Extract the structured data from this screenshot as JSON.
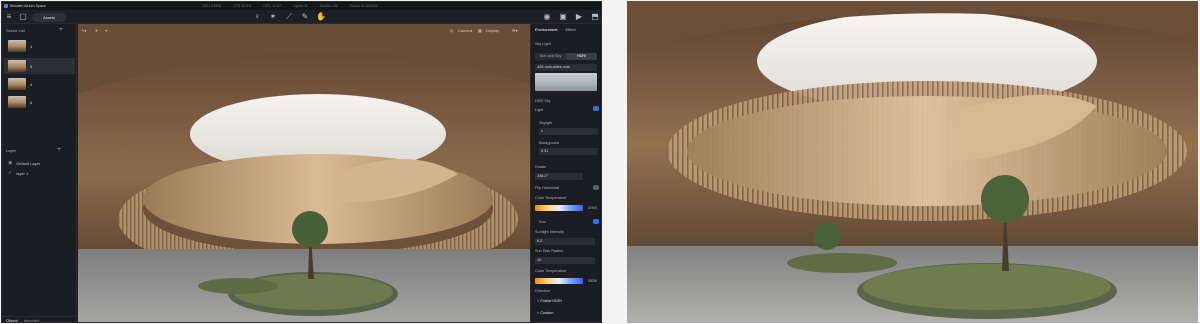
{
  "app": {
    "title": "Wooden Atrium Space",
    "stats": [
      "GPU 0.5MS",
      "FPS 59.9%",
      "CPU 14.87",
      "Lights 08",
      "Models 298",
      "Faces 81.8M/900"
    ],
    "assets_label": "Assets"
  },
  "viewport_toolbar": {
    "camera_label": "Camera",
    "display_label": "Display"
  },
  "left_panel": {
    "scene_list_label": "Scene List",
    "scenes": [
      "1",
      "3",
      "4",
      "6"
    ],
    "layer_label": "Layer",
    "layers": [
      "Default Layer",
      "layer 1"
    ],
    "footer_tabs": [
      "Object",
      "Imported"
    ]
  },
  "right_panel": {
    "tabs": [
      "Environment",
      "Effect"
    ],
    "sky_light_label": "Sky Light",
    "segments": [
      "Sun and Sky",
      "HDRI"
    ],
    "hdr_name": "429-rock-skies.com",
    "hdr_sky_label": "HDR Sky",
    "light_label": "Light",
    "skylight_label": "Skylight",
    "skylight_value": "1",
    "background_label": "Background",
    "background_value": "0.31",
    "rotate_label": "Rotate",
    "rotate_value": "248.2°",
    "flip_label": "Flip Horizontal",
    "color_temp_label": "Color Temperature",
    "color_temp_value": "6750K",
    "sun_label": "Sun",
    "sunlight_label": "Sunlight Intensity",
    "sunlight_value": "6.2",
    "sun_disk_label": "Sun Disk Radius",
    "sun_disk_value": "10",
    "color_temp2_label": "Color Temperature",
    "color_temp2_value": "5300K",
    "direction_label": "Direction",
    "follow_hdr_label": "Follow HDRI",
    "custom_label": "Custom"
  },
  "colors": {
    "accent": "#3d6cff",
    "panel_bg": "#1c1d22",
    "wood": "#b08a5e"
  }
}
